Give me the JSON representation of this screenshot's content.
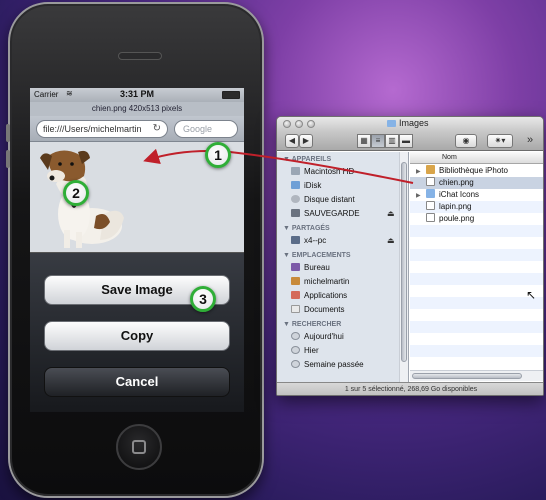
{
  "phone": {
    "status": {
      "carrier": "Carrier",
      "time": "3:31 PM"
    },
    "page_title": "chien.png 420x513 pixels",
    "url": "file:///Users/michelmartin",
    "search_placeholder": "Google",
    "action_sheet": {
      "save_label": "Save Image",
      "copy_label": "Copy",
      "cancel_label": "Cancel"
    }
  },
  "callouts": {
    "one": "1",
    "two": "2",
    "three": "3"
  },
  "finder": {
    "title": "Images",
    "sidebar": {
      "devices_header": "APPAREILS",
      "devices": [
        "Macintosh HD",
        "iDisk",
        "Disque distant",
        "SAUVEGARDE"
      ],
      "shared_header": "PARTAGÉS",
      "shared": [
        "x4--pc"
      ],
      "places_header": "EMPLACEMENTS",
      "places": [
        "Bureau",
        "michelmartin",
        "Applications",
        "Documents"
      ],
      "search_header": "RECHERCHER",
      "searches": [
        "Aujourd'hui",
        "Hier",
        "Semaine passée"
      ]
    },
    "column_header": "Nom",
    "files": [
      {
        "name": "Bibliothèque iPhoto",
        "icon": "iphoto-library-icon",
        "expandable": true
      },
      {
        "name": "chien.png",
        "icon": "png-file-icon",
        "expandable": false,
        "selected": true
      },
      {
        "name": "iChat Icons",
        "icon": "folder-icon",
        "expandable": true
      },
      {
        "name": "lapin.png",
        "icon": "png-file-icon",
        "expandable": false
      },
      {
        "name": "poule.png",
        "icon": "png-file-icon",
        "expandable": false
      }
    ],
    "status": "1 sur 5 sélectionné, 268,69 Go disponibles"
  },
  "colors": {
    "callout_ring": "#2fae37",
    "arrow": "#c0202a",
    "selection": "#c9d3e2"
  }
}
